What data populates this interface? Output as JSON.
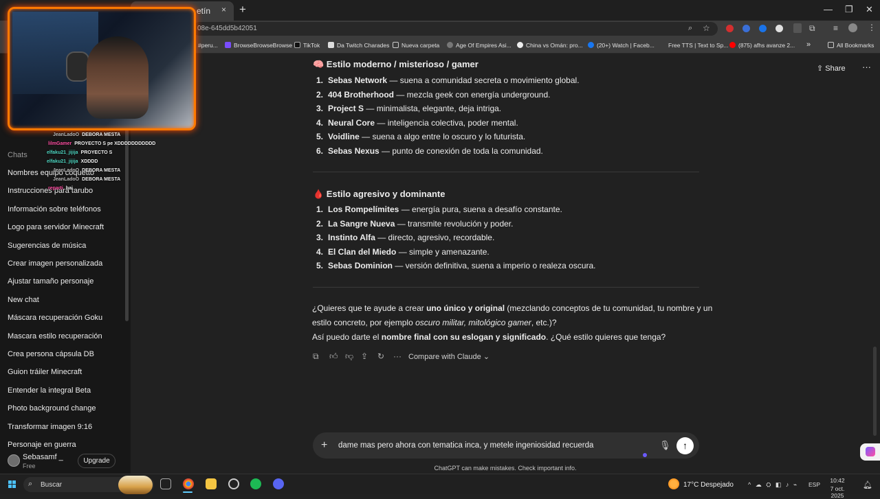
{
  "browser": {
    "tab_title": "etín",
    "tab_close": "×",
    "new_tab": "+",
    "url": "08e-645dd5b42051",
    "bookmarks": [
      {
        "label": "#peru..."
      },
      {
        "label": "BrowseBrowseBrowse"
      },
      {
        "label": "TikTok"
      },
      {
        "label": "Da Twitch Charades"
      },
      {
        "label": "Nueva carpeta"
      },
      {
        "label": "Age Of Empires Asi..."
      },
      {
        "label": "China vs Omán: pro..."
      },
      {
        "label": "(20+) Watch | Faceb..."
      },
      {
        "label": "Free TTS | Text to Sp..."
      },
      {
        "label": "(875) afhs avanze 2..."
      }
    ],
    "bookmarks_overflow": "»",
    "all_bookmarks": "All Bookmarks",
    "ext_colors": [
      "#d32f2f",
      "#3a6fd8",
      "#1a73e8",
      "#e0e0e0"
    ]
  },
  "sidebar": {
    "chats_heading": "Chats",
    "items": [
      "Nombres equipo coquetto",
      "Instrucciones para tarubo",
      "Información sobre teléfonos",
      "Logo para servidor Minecraft",
      "Sugerencias de música",
      "Crear imagen personalizada",
      "Ajustar tamaño personaje",
      "New chat",
      "Máscara recuperación Goku",
      "Mascara estilo recuperación",
      "Crea persona cápsula DB",
      "Guion tráiler Minecraft",
      "Entender la integral Beta",
      "Photo background change",
      "Transformar imagen 9:16",
      "Personaje en guerra"
    ],
    "user": {
      "name": "Sebasamf _",
      "plan": "Free"
    },
    "upgrade_label": "Upgrade"
  },
  "stream_overlay": {
    "messages": [
      {
        "user": "JeanLadoO",
        "text": "DEBORA MESTA"
      },
      {
        "user": "lilmGamer",
        "text": "PROYECTO S pe XDDDDDDDDDDD"
      },
      {
        "user": "elfaku21_jijija",
        "text": "PROYECTO S"
      },
      {
        "user": "elfaku21_jijija",
        "text": "XDDDD"
      },
      {
        "user": "JeanLadoO",
        "text": "DEBORA MESTA"
      },
      {
        "user": "JeanLadoO",
        "text": "DEBORA MESTA"
      },
      {
        "user": "reparti",
        "text": "bai"
      }
    ]
  },
  "header": {
    "share_label": "Share",
    "more_label": "···"
  },
  "conversation": {
    "section1": {
      "title": "🧠 Estilo moderno / misterioso / gamer",
      "items": [
        {
          "n": "1.",
          "name": "Sebas Network",
          "desc": " — suena a comunidad secreta o movimiento global."
        },
        {
          "n": "2.",
          "name": "404 Brotherhood",
          "desc": " — mezcla geek con energía underground."
        },
        {
          "n": "3.",
          "name": "Project S",
          "desc": " — minimalista, elegante, deja intriga."
        },
        {
          "n": "4.",
          "name": "Neural Core",
          "desc": " — inteligencia colectiva, poder mental."
        },
        {
          "n": "5.",
          "name": "Voidline",
          "desc": " — suena a algo entre lo oscuro y lo futurista."
        },
        {
          "n": "6.",
          "name": "Sebas Nexus",
          "desc": " — punto de conexión de toda la comunidad."
        }
      ]
    },
    "section2": {
      "title": "🩸 Estilo agresivo y dominante",
      "items": [
        {
          "n": "1.",
          "name": "Los Rompelímites",
          "desc": " — energía pura, suena a desafío constante."
        },
        {
          "n": "2.",
          "name": "La Sangre Nueva",
          "desc": " — transmite revolución y poder."
        },
        {
          "n": "3.",
          "name": "Instinto Alfa",
          "desc": " — directo, agresivo, recordable."
        },
        {
          "n": "4.",
          "name": "El Clan del Miedo",
          "desc": " — simple y amenazante."
        },
        {
          "n": "5.",
          "name": "Sebas Dominion",
          "desc": " — versión definitiva, suena a imperio o realeza oscura."
        }
      ]
    },
    "closing": {
      "l1_a": "¿Quieres que te ayude a crear ",
      "l1_b": "uno único y original",
      "l1_c": " (mezclando conceptos de tu comunidad, tu nombre y un",
      "l2_a": "estilo concreto, por ejemplo ",
      "l2_b": "oscuro militar, mitológico gamer",
      "l2_c": ", etc.)?",
      "l3_a": "Así puedo darte el ",
      "l3_b": "nombre final con su eslogan y significado",
      "l3_c": ". ¿Qué estilo quieres que tenga?"
    },
    "compare_label": "Compare with Claude ⌄"
  },
  "composer": {
    "text": "dame mas pero ahora con tematica inca, y metele ingeniosidad recuerda",
    "disclaimer": "ChatGPT can make mistakes. Check important info."
  },
  "taskbar": {
    "search_label": "Buscar",
    "weather": "17°C  Despejado",
    "lang": "ESP",
    "time": "10:42",
    "date": "7 oct. 2025"
  }
}
